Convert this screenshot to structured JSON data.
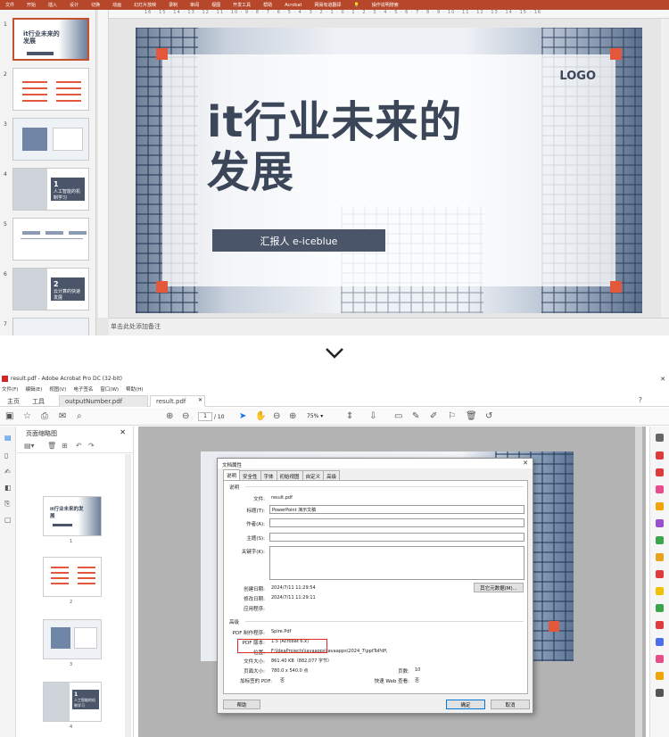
{
  "ppt": {
    "ribbon_tabs": [
      "文件",
      "开始",
      "插入",
      "设计",
      "切换",
      "动画",
      "幻灯片放映",
      "录制",
      "审阅",
      "视图",
      "开发工具",
      "帮助",
      "Acrobat",
      "网易有道翻译",
      "操作说明搜索"
    ],
    "thumb_numbers": [
      "1",
      "2",
      "3",
      "4",
      "5",
      "6",
      "7"
    ],
    "thumb1_title": "it行业未来的发展",
    "thumb4_num": "1",
    "thumb4_text": "人工智能的机制学习",
    "thumb6_num": "2",
    "thumb6_text": "云计算的快速发展",
    "ruler_marks": "16 · 15 · 14 · 13 · 12 · 11 · 10 · 9 · 8 · 7 · 6 · 5 · 4 · 3 · 2 · 1 · 0 · 1 · 2 · 3 · 4 · 5 · 6 · 7 · 8 · 9 · 10 · 11 · 12 · 13 · 14 · 15 · 16",
    "slide": {
      "title_line1": "it行业未来的",
      "title_line2": "发展",
      "logo": "LOGO",
      "reporter": "汇报人 e-iceblue"
    },
    "notes_placeholder": "单击此处添加备注"
  },
  "acrobat": {
    "window_title": "result.pdf - Adobe Acrobat Pro DC (32-bit)",
    "menu": [
      "文件(F)",
      "编辑(E)",
      "视图(V)",
      "电子签名",
      "窗口(W)",
      "帮助(H)"
    ],
    "home_tab": "主页",
    "tools_tab": "工具",
    "doc_tabs": [
      "outputNumber.pdf",
      "result.pdf"
    ],
    "page_current": "1",
    "page_total": "/ 10",
    "zoom": "75%",
    "panel_title": "页面缩略图",
    "thumb_numbers": [
      "1",
      "2",
      "3",
      "4"
    ],
    "thumb1_title": "it行业未来的发展",
    "thumb4_num": "1",
    "thumb4_text": "人工智能的机制学习"
  },
  "dialog": {
    "title": "文档属性",
    "tabs": [
      "说明",
      "安全性",
      "字体",
      "初始视图",
      "自定义",
      "高级"
    ],
    "section_desc": "说明",
    "labels": {
      "file": "文件:",
      "title": "标题(T):",
      "author": "作者(A):",
      "subject": "主题(S):",
      "keywords": "关键字(K):",
      "created": "创建日期:",
      "modified": "修改日期:",
      "application": "应用程序:",
      "producer": "PDF 制作程序:",
      "version": "PDF 版本:",
      "location": "位置:",
      "filesize": "文件大小:",
      "pagesize": "页面大小:",
      "pages": "页数:",
      "tagged": "加标签的 PDF:",
      "fastweb": "快速 Web 查看:"
    },
    "values": {
      "file": "result.pdf",
      "title": "PowerPoint 演示文稿",
      "created": "2024/7/11 11:29:54",
      "modified": "2024/7/11 11:29:11",
      "producer": "Spire.Pdf",
      "version": "1.5 (Acrobat 6.x)",
      "location": "F:\\IdeaProjects\\javaapps\\javaapps\\2024_7\\pptToPdf\\",
      "filesize": "861.40 KB（882,077 字节）",
      "pagesize": "780.0 x 540.0 点",
      "pages": "10",
      "tagged": "否",
      "fastweb": "否"
    },
    "section_adv": "高级",
    "metadata_button": "其它元数据(M)...",
    "help_button": "帮助",
    "ok_button": "确定",
    "cancel_button": "取消"
  }
}
